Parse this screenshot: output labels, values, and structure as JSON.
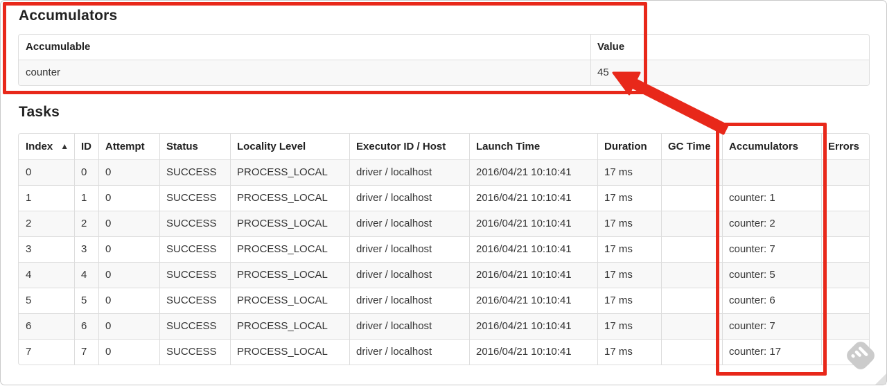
{
  "accumulators": {
    "title": "Accumulators",
    "headers": [
      "Accumulable",
      "Value"
    ],
    "rows": [
      [
        "counter",
        "45"
      ]
    ]
  },
  "tasks": {
    "title": "Tasks",
    "sort_icon": "▲",
    "sorted_column": "Index",
    "headers": [
      "Index",
      "ID",
      "Attempt",
      "Status",
      "Locality Level",
      "Executor ID / Host",
      "Launch Time",
      "Duration",
      "GC Time",
      "Accumulators",
      "Errors"
    ],
    "rows": [
      [
        "0",
        "0",
        "0",
        "SUCCESS",
        "PROCESS_LOCAL",
        "driver / localhost",
        "2016/04/21 10:10:41",
        "17 ms",
        "",
        "",
        ""
      ],
      [
        "1",
        "1",
        "0",
        "SUCCESS",
        "PROCESS_LOCAL",
        "driver / localhost",
        "2016/04/21 10:10:41",
        "17 ms",
        "",
        "counter: 1",
        ""
      ],
      [
        "2",
        "2",
        "0",
        "SUCCESS",
        "PROCESS_LOCAL",
        "driver / localhost",
        "2016/04/21 10:10:41",
        "17 ms",
        "",
        "counter: 2",
        ""
      ],
      [
        "3",
        "3",
        "0",
        "SUCCESS",
        "PROCESS_LOCAL",
        "driver / localhost",
        "2016/04/21 10:10:41",
        "17 ms",
        "",
        "counter: 7",
        ""
      ],
      [
        "4",
        "4",
        "0",
        "SUCCESS",
        "PROCESS_LOCAL",
        "driver / localhost",
        "2016/04/21 10:10:41",
        "17 ms",
        "",
        "counter: 5",
        ""
      ],
      [
        "5",
        "5",
        "0",
        "SUCCESS",
        "PROCESS_LOCAL",
        "driver / localhost",
        "2016/04/21 10:10:41",
        "17 ms",
        "",
        "counter: 6",
        ""
      ],
      [
        "6",
        "6",
        "0",
        "SUCCESS",
        "PROCESS_LOCAL",
        "driver / localhost",
        "2016/04/21 10:10:41",
        "17 ms",
        "",
        "counter: 7",
        ""
      ],
      [
        "7",
        "7",
        "0",
        "SUCCESS",
        "PROCESS_LOCAL",
        "driver / localhost",
        "2016/04/21 10:10:41",
        "17 ms",
        "",
        "counter: 17",
        ""
      ]
    ]
  },
  "annotations": {
    "color": "#e8281a",
    "highlighted_value": "45",
    "highlighted_column": "Accumulators"
  },
  "icons": {
    "sort": "sort-ascending-icon",
    "watermark": "annotation-stamp-icon"
  }
}
